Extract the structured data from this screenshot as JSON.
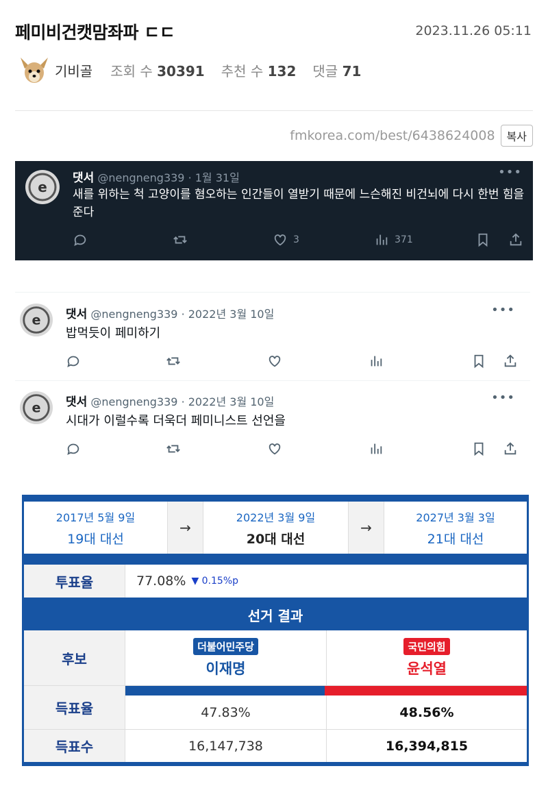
{
  "post": {
    "title": "페미비건캣맘좌파 ㄷㄷ",
    "date": "2023.11.26 05:11",
    "author": "기비골",
    "views_label": "조회 수",
    "views": "30391",
    "recommend_label": "추천 수",
    "recommend": "132",
    "comments_label": "댓글",
    "comments": "71",
    "url": "fmkorea.com/best/6438624008",
    "copy_label": "복사"
  },
  "tweets": [
    {
      "name": "댓서",
      "handle_date": "@nengneng339 · 1월 31일",
      "text": "새를 위하는 척 고양이를 혐오하는 인간들이 열받기 때문에 느슨해진 비건뇌에 다시 한번 힘을 준다",
      "likes": "3",
      "views": "371"
    },
    {
      "name": "댓서",
      "handle_date": "@nengneng339 · 2022년 3월 10일",
      "text": "밥먹듯이 페미하기"
    },
    {
      "name": "댓서",
      "handle_date": "@nengneng339 · 2022년 3월 10일",
      "text": "시대가 이럴수록 더욱더 페미니스트 선언을"
    }
  ],
  "election": {
    "timeline": [
      {
        "date": "2017년 5월 9일",
        "name": "19대 대선"
      },
      {
        "date": "2022년 3월 9일",
        "name": "20대 대선"
      },
      {
        "date": "2027년 3월 3일",
        "name": "21대 대선"
      }
    ],
    "arrow": "→",
    "turnout_label": "투표율",
    "turnout": "77.08%",
    "turnout_delta": "▼ 0.15%p",
    "result_header": "선거 결과",
    "candidate_label": "후보",
    "vote_rate_label": "득표율",
    "vote_count_label": "득표수",
    "candidates": [
      {
        "party": "더불어민주당",
        "name": "이재명",
        "rate": "47.83%",
        "votes": "16,147,738",
        "color": "#1755a4"
      },
      {
        "party": "국민의힘",
        "name": "윤석열",
        "rate": "48.56%",
        "votes": "16,394,815",
        "color": "#e61e2b"
      }
    ]
  }
}
